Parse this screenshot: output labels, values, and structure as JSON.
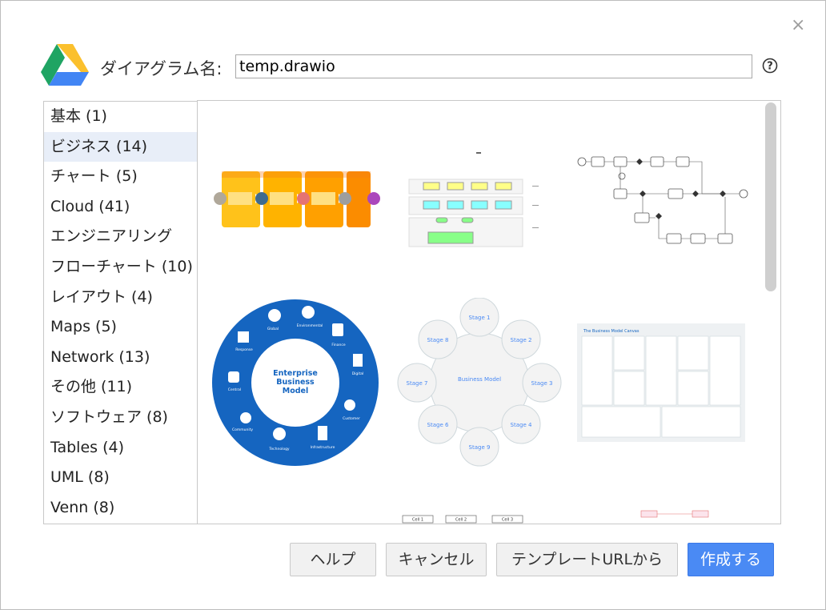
{
  "dialog": {
    "name_label": "ダイアグラム名:",
    "filename": "temp.drawio",
    "close_glyph": "×",
    "help_glyph": "?"
  },
  "categories": [
    {
      "label": "基本 (1)"
    },
    {
      "label": "ビジネス (14)",
      "selected": true
    },
    {
      "label": "チャート (5)"
    },
    {
      "label": "Cloud (41)"
    },
    {
      "label": "エンジニアリング"
    },
    {
      "label": "フローチャート (10)"
    },
    {
      "label": "レイアウト (4)"
    },
    {
      "label": "Maps (5)"
    },
    {
      "label": "Network (13)"
    },
    {
      "label": "その他 (11)"
    },
    {
      "label": "ソフトウェア (8)"
    },
    {
      "label": "Tables (4)"
    },
    {
      "label": "UML (8)"
    },
    {
      "label": "Venn (8)"
    }
  ],
  "thumbnails": {
    "enterprise": {
      "title": "Enterprise Business Model"
    },
    "cycle": {
      "center": "Business Model",
      "stages": [
        "Stage 1",
        "Stage 2",
        "Stage 3",
        "Stage 4",
        "Stage 9",
        "Stage 6",
        "Stage 7",
        "Stage 8"
      ]
    },
    "canvas": {
      "title": "The Business Model Canvas"
    },
    "cells": [
      "Cell 1",
      "Cell 2",
      "Cell 3"
    ]
  },
  "buttons": {
    "help": "ヘルプ",
    "cancel": "キャンセル",
    "from_url": "テンプレートURLから",
    "create": "作成する"
  },
  "colors": {
    "primary_button": "#4a8af4",
    "selected_category": "#e8eef8",
    "enterprise_blue": "#1565c0"
  }
}
